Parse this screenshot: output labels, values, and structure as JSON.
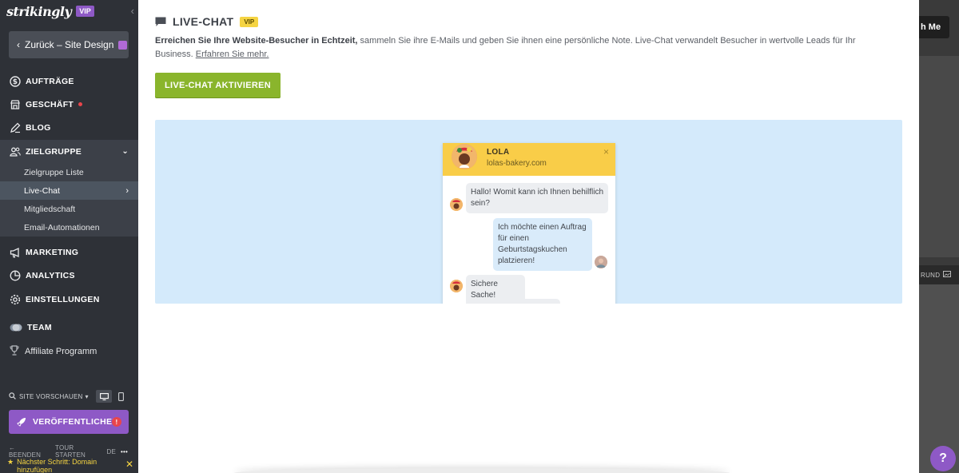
{
  "sidebar": {
    "logo": "strikingly",
    "logo_badge": "VIP",
    "back_label": "Zurück – Site Design",
    "nav": [
      {
        "label": "AUFTRÄGE",
        "icon": "dollar-circle-icon"
      },
      {
        "label": "GESCHÄFT",
        "icon": "store-icon"
      },
      {
        "label": "BLOG",
        "icon": "pen-icon"
      },
      {
        "label": "ZIELGRUPPE",
        "icon": "audience-icon"
      },
      {
        "label": "MARKETING",
        "icon": "megaphone-icon"
      },
      {
        "label": "ANALYTICS",
        "icon": "pie-chart-icon"
      },
      {
        "label": "EINSTELLUNGEN",
        "icon": "gear-icon"
      },
      {
        "label": "TEAM",
        "icon": "team-icon"
      }
    ],
    "subnav": [
      {
        "label": "Zielgruppe Liste"
      },
      {
        "label": "Live-Chat"
      },
      {
        "label": "Mitgliedschaft"
      },
      {
        "label": "Email-Automationen"
      }
    ],
    "affiliate": "Affiliate Programm",
    "preview_label": "SITE VORSCHAUEN",
    "publish_label": "VERÖFFENTLICHEN",
    "publish_warning": "!",
    "footer": {
      "exit": "BEENDEN",
      "tour": "TOUR STARTEN",
      "lang": "DE",
      "more": "•••"
    },
    "next_step": "Nächster Schritt: Domain hinzufügen"
  },
  "main": {
    "title": "LIVE-CHAT",
    "title_badge": "VIP",
    "desc_bold": "Erreichen Sie Ihre Website-Besucher in Echtzeit,",
    "desc_rest": " sammeln Sie ihre E-Mails und geben Sie ihnen eine persönliche Note. Live-Chat verwandelt Besucher in wertvolle Leads für Ihr Business. ",
    "desc_link": "Erfahren Sie mehr.",
    "activate_label": "LIVE-CHAT AKTIVIEREN"
  },
  "widget": {
    "name": "LOLA",
    "site": "lolas-bakery.com",
    "close": "×",
    "messages": [
      {
        "from": "agent",
        "text": "Hallo! Womit kann ich Ihnen behilflich sein?"
      },
      {
        "from": "user",
        "text": "Ich möchte einen Auftrag für einen Geburtstagskuchen platzieren!"
      },
      {
        "from": "agent",
        "text": "Sichere Sache!"
      }
    ]
  },
  "background": {
    "button_fragment": "h Me",
    "label_fragment": "RUND"
  },
  "help_label": "?",
  "colors": {
    "sidebar": "#2e3137",
    "accent_purple": "#8e59c6",
    "activate_green": "#8ab52c",
    "vip_yellow": "#f5d442",
    "preview_blue": "#d4eafb"
  }
}
